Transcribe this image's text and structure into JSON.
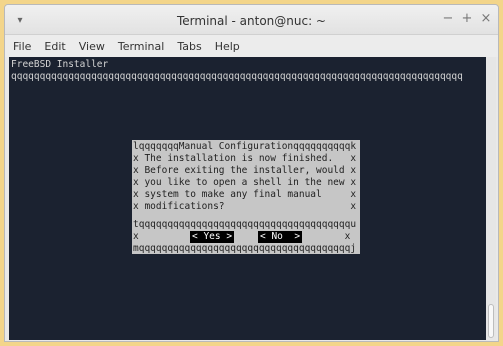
{
  "window": {
    "title": "Terminal - anton@nuc: ~",
    "menu_icon": "chevron-down-icon",
    "controls": [
      "−",
      "+",
      "×"
    ]
  },
  "menubar": [
    "File",
    "Edit",
    "View",
    "Terminal",
    "Tabs",
    "Help"
  ],
  "terminal": {
    "heading": "FreeBSD Installer",
    "rule": "qqqqqqqqqqqqqqqqqqqqqqqqqqqqqqqqqqqqqqqqqqqqqqqqqqqqqqqqqqqqqqqqqqqqqqqqqqqqqqq"
  },
  "dialog": {
    "top_border": "lqqqqqqqManual Configurationqqqqqqqqqqk",
    "lines": [
      "x The installation is now finished.   x",
      "x Before exiting the installer, would x",
      "x you like to open a shell in the new x",
      "x system to make any final manual     x",
      "x modifications?                      x"
    ],
    "separator": "tqqqqqqqqqqqqqqqqqqqqqqqqqqqqqqqqqqqqqu",
    "button_row": "x                                    x",
    "bottom_border": "mqqqqqqqqqqqqqqqqqqqqqqqqqqqqqqqqqqqqqj",
    "yes_label": "< Yes >",
    "no_label": "< No  >"
  }
}
